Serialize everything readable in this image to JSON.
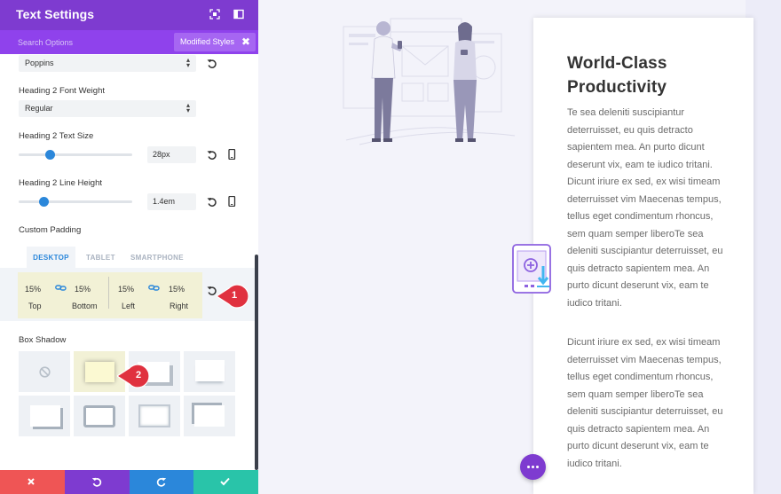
{
  "panel": {
    "title": "Text Settings",
    "search_placeholder": "Search Options",
    "filter_label": "Modified Styles",
    "filter_close": "✖"
  },
  "font_select": {
    "value": "Poppins"
  },
  "weight": {
    "label": "Heading 2 Font Weight",
    "value": "Regular"
  },
  "text_size": {
    "label": "Heading 2 Text Size",
    "value": "28px",
    "slider_fraction": 0.28
  },
  "line_height": {
    "label": "Heading 2 Line Height",
    "value": "1.4em",
    "slider_fraction": 0.22
  },
  "padding": {
    "label": "Custom Padding",
    "tabs": [
      "DESKTOP",
      "TABLET",
      "SMARTPHONE"
    ],
    "fields": [
      {
        "value": "15%",
        "label": "Top"
      },
      {
        "value": "15%",
        "label": "Bottom"
      },
      {
        "value": "15%",
        "label": "Left"
      },
      {
        "value": "15%",
        "label": "Right"
      }
    ]
  },
  "box_shadow": {
    "label": "Box Shadow"
  },
  "callouts": [
    "1",
    "2"
  ],
  "card": {
    "title": "World-Class Productivity",
    "paragraph1": "Te sea deleniti suscipiantur deterruisset, eu quis detracto sapientem mea. An purto dicunt deserunt vix, eam te iudico tritani. Dicunt iriure ex sed, ex wisi timeam deterruisset vim Maecenas tempus, tellus eget condimentum rhoncus, sem quam semper liberoTe sea deleniti suscipiantur deterruisset, eu quis detracto sapientem mea. An purto dicunt deserunt vix, eam te iudico tritani.",
    "paragraph2": "Dicunt iriure ex sed, ex wisi timeam deterruisset vim Maecenas tempus, tellus eget condimentum rhoncus, sem quam semper liberoTe sea deleniti suscipiantur deterruisset, eu quis detracto sapientem mea. An purto dicunt deserunt vix, eam te iudico tritani."
  },
  "colors": {
    "header_purple": "#7e3bd0",
    "search_purple": "#8f42ec",
    "accent_blue": "#2b87da",
    "callout_red": "#e0313f",
    "highlight_yellow": "#f2f1d6",
    "footer_red": "#ef5555",
    "footer_purple": "#7e3bd0",
    "footer_blue": "#2b87da",
    "footer_green": "#29c4a9"
  },
  "icons": {
    "header": [
      "fullscreen-icon",
      "sidebar-toggle-icon"
    ],
    "footer": [
      "close-icon",
      "undo-icon",
      "redo-icon",
      "check-icon"
    ]
  }
}
